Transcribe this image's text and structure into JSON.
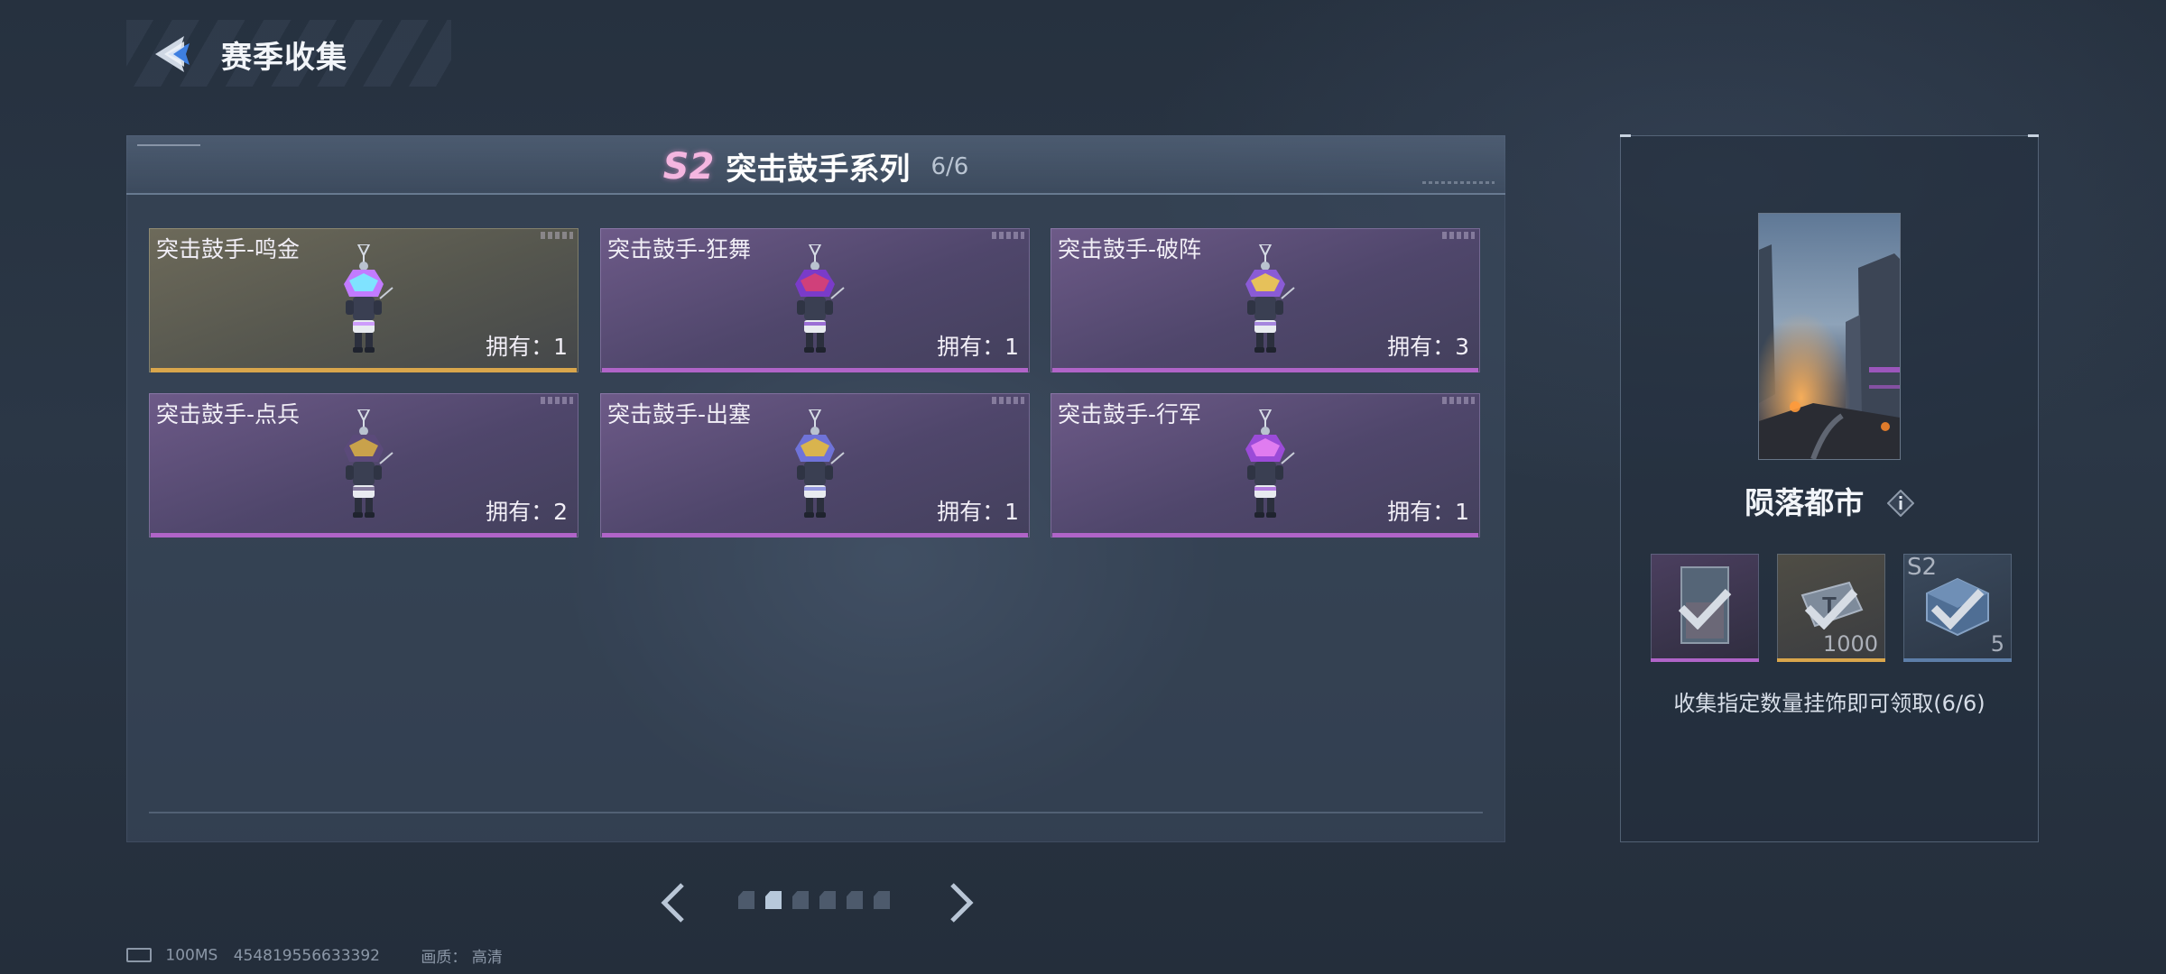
{
  "header": {
    "title": "赛季收集"
  },
  "series": {
    "badge": "S2",
    "name": "突击鼓手系列",
    "progress": "6/6"
  },
  "items": [
    {
      "name": "突击鼓手-鸣金",
      "owned": "拥有：1",
      "rarity": "gold",
      "accent": "#d9a64c",
      "visor": [
        "#7fe3ff",
        "#c27bff"
      ]
    },
    {
      "name": "突击鼓手-狂舞",
      "owned": "拥有：1",
      "rarity": "purple",
      "accent": "#b064c8",
      "visor": [
        "#d0407a",
        "#7a3bc9"
      ]
    },
    {
      "name": "突击鼓手-破阵",
      "owned": "拥有：3",
      "rarity": "purple",
      "accent": "#b064c8",
      "visor": [
        "#e6c15a",
        "#8a5bd6"
      ]
    },
    {
      "name": "突击鼓手-点兵",
      "owned": "拥有：2",
      "rarity": "purple",
      "accent": "#b064c8",
      "visor": [
        "#c9a24b",
        "#5b4a7a"
      ]
    },
    {
      "name": "突击鼓手-出塞",
      "owned": "拥有：1",
      "rarity": "purple",
      "accent": "#b064c8",
      "visor": [
        "#d9b44e",
        "#6f73d8"
      ]
    },
    {
      "name": "突击鼓手-行军",
      "owned": "拥有：1",
      "rarity": "purple",
      "accent": "#b064c8",
      "visor": [
        "#e07cf0",
        "#9b4bd8"
      ]
    }
  ],
  "pagination": {
    "total": 6,
    "current": 2
  },
  "status": {
    "ping": "100MS",
    "uid": "454819556633392",
    "quality_label": "画质：",
    "quality_value": "高清"
  },
  "reward": {
    "name": "陨落都市",
    "slots": [
      {
        "kind": "card",
        "quantity": "",
        "tag": "",
        "rarity_color": "#b064c8",
        "claimed": true
      },
      {
        "kind": "coupon",
        "quantity": "1000",
        "tag": "",
        "rarity_color": "#d9a64c",
        "claimed": true
      },
      {
        "kind": "crate",
        "quantity": "5",
        "tag": "S2",
        "rarity_color": "#5d7ea8",
        "claimed": true
      }
    ],
    "description": "收集指定数量挂饰即可领取(6/6)"
  }
}
